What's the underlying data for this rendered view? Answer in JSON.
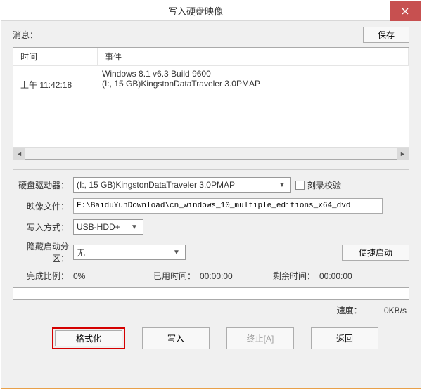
{
  "window": {
    "title": "写入硬盘映像"
  },
  "toolbar": {
    "message_label": "消息：",
    "save_label": "保存"
  },
  "log": {
    "col_time": "时间",
    "col_event": "事件",
    "rows": [
      {
        "time": "",
        "event": "Windows 8.1 v6.3 Build 9600"
      },
      {
        "time": "上午 11:42:18",
        "event": "(I:, 15 GB)KingstonDataTraveler 3.0PMAP"
      }
    ]
  },
  "form": {
    "drive_label": "硬盘驱动器：",
    "drive_value": "(I:, 15 GB)KingstonDataTraveler 3.0PMAP",
    "verify_label": "刻录校验",
    "image_label": "映像文件：",
    "image_value": "F:\\BaiduYunDownload\\cn_windows_10_multiple_editions_x64_dvd",
    "method_label": "写入方式：",
    "method_value": "USB-HDD+",
    "hidden_label": "隐藏启动分区：",
    "hidden_value": "无",
    "quickboot_label": "便捷启动"
  },
  "status": {
    "progress_label": "完成比例：",
    "progress_value": "0%",
    "elapsed_label": "已用时间：",
    "elapsed_value": "00:00:00",
    "remain_label": "剩余时间：",
    "remain_value": "00:00:00",
    "speed_label": "速度：",
    "speed_value": "0KB/s"
  },
  "buttons": {
    "format": "格式化",
    "write": "写入",
    "abort": "终止[A]",
    "back": "返回"
  }
}
